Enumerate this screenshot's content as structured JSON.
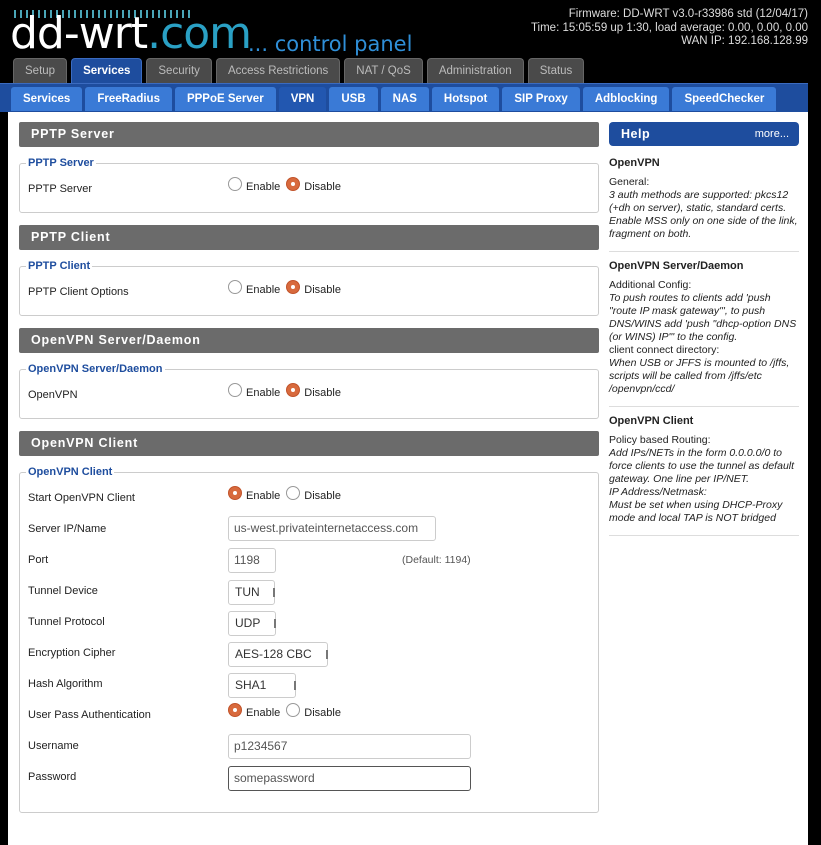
{
  "header": {
    "logo_main": "dd-wrt",
    "logo_dot": ".com",
    "logo_sub": "... control panel",
    "firmware": "Firmware: DD-WRT v3.0-r33986 std (12/04/17)",
    "time": "Time: 15:05:59 up 1:30, load average: 0.00, 0.00, 0.00",
    "wan": "WAN IP: 192.168.128.99"
  },
  "main_tabs": [
    "Setup",
    "Services",
    "Security",
    "Access Restrictions",
    "NAT / QoS",
    "Administration",
    "Status"
  ],
  "sub_tabs": [
    "Services",
    "FreeRadius",
    "PPPoE Server",
    "VPN",
    "USB",
    "NAS",
    "Hotspot",
    "SIP Proxy",
    "Adblocking",
    "SpeedChecker"
  ],
  "radio": {
    "enable": "Enable",
    "disable": "Disable"
  },
  "pptp_server": {
    "bar": "PPTP Server",
    "legend": "PPTP Server",
    "label": "PPTP Server",
    "value": "Disable"
  },
  "pptp_client": {
    "bar": "PPTP Client",
    "legend": "PPTP Client",
    "label": "PPTP Client Options",
    "value": "Disable"
  },
  "openvpn_server": {
    "bar": "OpenVPN Server/Daemon",
    "legend": "OpenVPN Server/Daemon",
    "label": "OpenVPN",
    "value": "Disable"
  },
  "openvpn_client": {
    "bar": "OpenVPN Client",
    "legend": "OpenVPN Client",
    "start_label": "Start OpenVPN Client",
    "start_value": "Enable",
    "server_label": "Server IP/Name",
    "server_value": "us-west.privateinternetaccess.com",
    "port_label": "Port",
    "port_value": "1198",
    "port_hint": "(Default: 1194)",
    "tunnel_device_label": "Tunnel Device",
    "tunnel_device_value": "TUN",
    "tunnel_protocol_label": "Tunnel Protocol",
    "tunnel_protocol_value": "UDP",
    "cipher_label": "Encryption Cipher",
    "cipher_value": "AES-128 CBC",
    "hash_label": "Hash Algorithm",
    "hash_value": "SHA1",
    "userpass_label": "User Pass Authentication",
    "userpass_value": "Enable",
    "username_label": "Username",
    "username_value": "p1234567",
    "password_label": "Password",
    "password_value": "somepassword"
  },
  "help": {
    "title": "Help",
    "more": "more...",
    "block1_title": "OpenVPN",
    "block1_line1": "General:",
    "block1_line2": "3 auth methods are supported: pkcs12 (+dh on server), static, standard certs. Enable MSS only on one side of the link, fragment on both.",
    "block2_title": "OpenVPN Server/Daemon",
    "block2_line1": "Additional Config:",
    "block2_line2": "To push routes to clients add 'push \"route IP mask gateway\"', to push DNS/WINS add 'push \"dhcp-option DNS (or WINS) IP\"' to the config.",
    "block2_line3": "client connect directory:",
    "block2_line4": "When USB or JFFS is mounted to /jffs, scripts will be called from /jffs/etc /openvpn/ccd/",
    "block3_title": "OpenVPN Client",
    "block3_line1": "Policy based Routing:",
    "block3_line2": "Add IPs/NETs in the form 0.0.0.0/0 to force clients to use the tunnel as default gateway. One line per IP/NET.",
    "block3_line3": "IP Address/Netmask:",
    "block3_line4": "Must be set when using DHCP-Proxy mode and local TAP is NOT bridged"
  }
}
